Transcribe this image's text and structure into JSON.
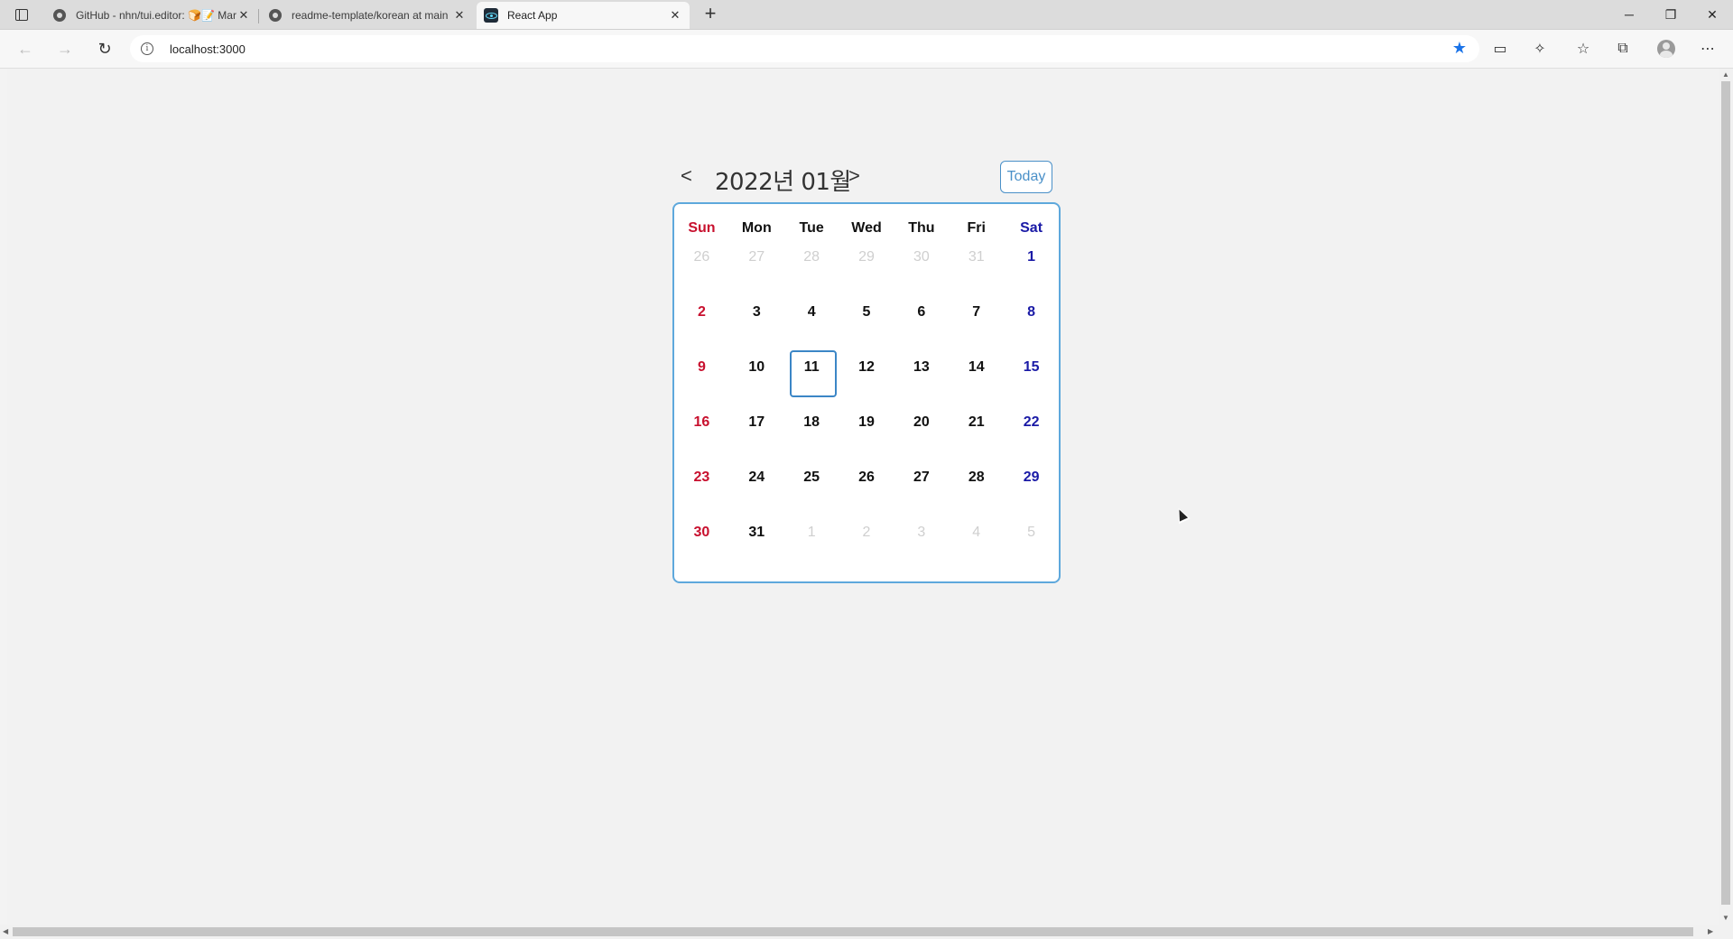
{
  "browser": {
    "tabs": [
      {
        "title": "GitHub - nhn/tui.editor: 🍞📝 Markdown",
        "active": false,
        "favicon": "github-icon"
      },
      {
        "title": "readme-template/korean at main",
        "active": false,
        "favicon": "github-icon"
      },
      {
        "title": "React App",
        "active": true,
        "favicon": "react-icon"
      }
    ],
    "url": "localhost:3000"
  },
  "calendar": {
    "prev_label": "<",
    "next_label": ">",
    "month_title": "2022년 01월",
    "today_label": "Today",
    "weekdays": [
      "Sun",
      "Mon",
      "Tue",
      "Wed",
      "Thu",
      "Fri",
      "Sat"
    ],
    "weeks": [
      [
        {
          "d": "26",
          "muted": true
        },
        {
          "d": "27",
          "muted": true
        },
        {
          "d": "28",
          "muted": true
        },
        {
          "d": "29",
          "muted": true
        },
        {
          "d": "30",
          "muted": true
        },
        {
          "d": "31",
          "muted": true
        },
        {
          "d": "1",
          "muted": false
        }
      ],
      [
        {
          "d": "2"
        },
        {
          "d": "3"
        },
        {
          "d": "4"
        },
        {
          "d": "5"
        },
        {
          "d": "6"
        },
        {
          "d": "7"
        },
        {
          "d": "8"
        }
      ],
      [
        {
          "d": "9"
        },
        {
          "d": "10"
        },
        {
          "d": "11",
          "today": true
        },
        {
          "d": "12"
        },
        {
          "d": "13"
        },
        {
          "d": "14"
        },
        {
          "d": "15"
        }
      ],
      [
        {
          "d": "16"
        },
        {
          "d": "17"
        },
        {
          "d": "18"
        },
        {
          "d": "19"
        },
        {
          "d": "20"
        },
        {
          "d": "21"
        },
        {
          "d": "22"
        }
      ],
      [
        {
          "d": "23"
        },
        {
          "d": "24"
        },
        {
          "d": "25"
        },
        {
          "d": "26"
        },
        {
          "d": "27"
        },
        {
          "d": "28"
        },
        {
          "d": "29"
        }
      ],
      [
        {
          "d": "30"
        },
        {
          "d": "31"
        },
        {
          "d": "1",
          "muted": true
        },
        {
          "d": "2",
          "muted": true
        },
        {
          "d": "3",
          "muted": true
        },
        {
          "d": "4",
          "muted": true
        },
        {
          "d": "5",
          "muted": true
        }
      ]
    ],
    "colors": {
      "sunday": "#c8102e",
      "saturday": "#1a1aa6",
      "border": "#5ea8dc",
      "muted": "#cfcfcf"
    }
  }
}
